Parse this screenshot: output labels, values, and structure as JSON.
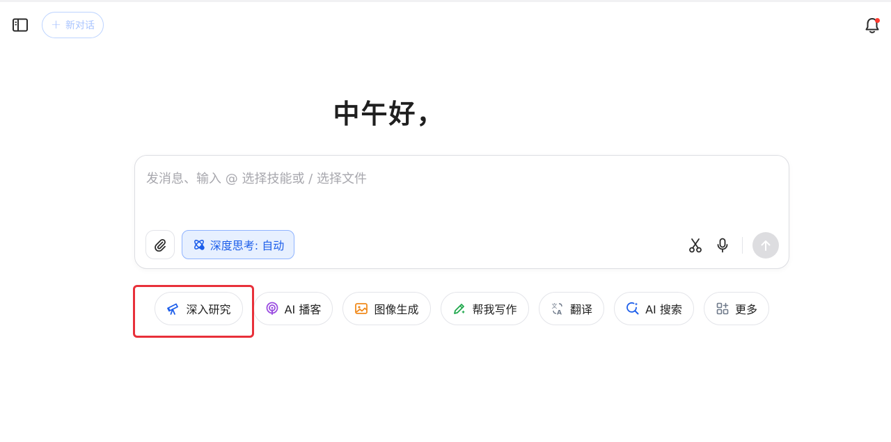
{
  "header": {
    "new_chat_label": "新对话"
  },
  "main": {
    "greeting": "中午好，"
  },
  "composer": {
    "placeholder": "发消息、输入 @ 选择技能或 / 选择文件",
    "deep_think_label": "深度思考: 自动"
  },
  "skills": [
    {
      "label": "深入研究",
      "icon": "telescope-icon",
      "color": "#1d5eea"
    },
    {
      "label": "AI 播客",
      "icon": "podcast-icon",
      "color": "#9b4de0"
    },
    {
      "label": "图像生成",
      "icon": "image-icon",
      "color": "#f08a1c"
    },
    {
      "label": "帮我写作",
      "icon": "pen-icon",
      "color": "#1fa84c"
    },
    {
      "label": "翻译",
      "icon": "translate-icon",
      "color": "#6f7a8a"
    },
    {
      "label": "AI 搜索",
      "icon": "search-icon",
      "color": "#1d5eea"
    },
    {
      "label": "更多",
      "icon": "apps-icon",
      "color": "#6f7a8a"
    }
  ],
  "colors": {
    "accent": "#1d5eea",
    "highlight": "#e8303a",
    "notification_dot": "#ff3b30"
  }
}
